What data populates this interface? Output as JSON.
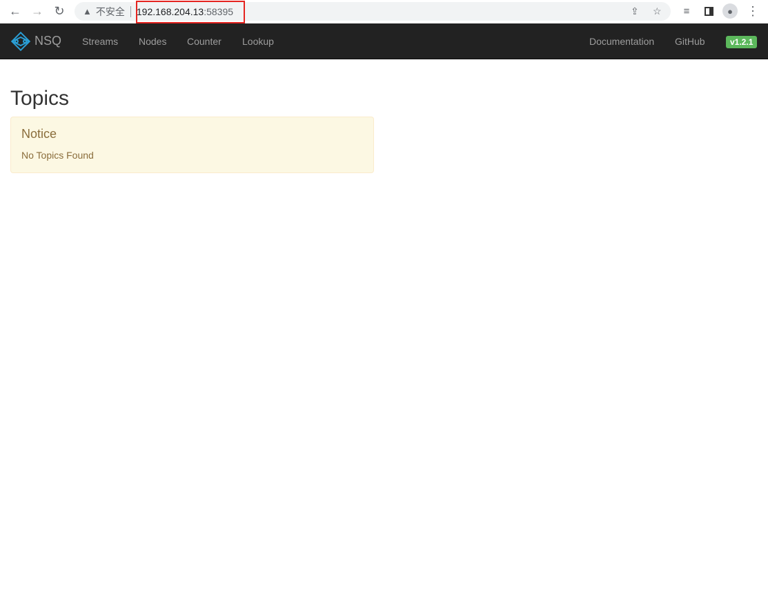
{
  "browser": {
    "security_label": "不安全",
    "url_host": "192.168.204.13",
    "url_port": ":58395"
  },
  "navbar": {
    "brand": "NSQ",
    "items": [
      "Streams",
      "Nodes",
      "Counter",
      "Lookup"
    ],
    "right_items": [
      "Documentation",
      "GitHub"
    ],
    "version": "v1.2.1",
    "version_color": "#5cb85c"
  },
  "main": {
    "title": "Topics",
    "notice": {
      "heading": "Notice",
      "message": "No Topics Found"
    }
  }
}
